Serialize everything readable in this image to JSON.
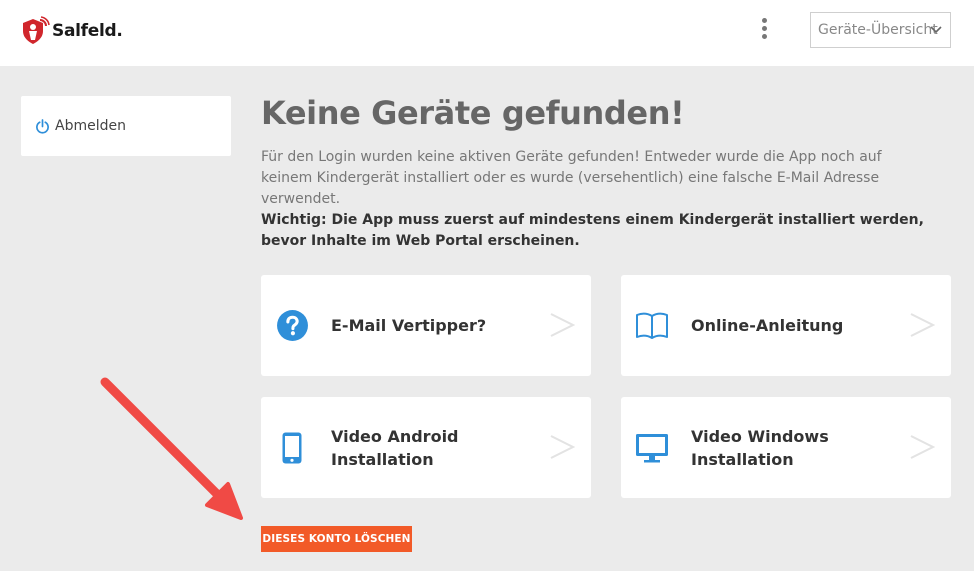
{
  "header": {
    "logo_text": "Salfeld.",
    "device_select": {
      "value": "Geräte-Übersicht"
    }
  },
  "sidebar": {
    "logout_label": "Abmelden"
  },
  "main": {
    "title": "Keine Geräte gefunden!",
    "description": "Für den Login wurden keine aktiven Geräte gefunden! Entweder wurde die App noch auf keinem Kindergerät installiert oder es wurde (versehentlich) eine falsche E-Mail Adresse verwendet.",
    "important": "Wichtig: Die App muss zuerst auf mindestens einem Kindergerät installiert werden, bevor Inhalte im Web Portal erscheinen."
  },
  "cards": [
    {
      "label": "E-Mail Vertipper?",
      "icon": "question-circle-icon"
    },
    {
      "label": "Online-Anleitung",
      "icon": "book-icon"
    },
    {
      "label": "Video Android Installation",
      "icon": "smartphone-icon"
    },
    {
      "label": "Video Windows Installation",
      "icon": "monitor-icon"
    }
  ],
  "delete_button": {
    "label": "DIESES KONTO LÖSCHEN"
  },
  "colors": {
    "accent": "#f25a28",
    "icon_blue": "#2f8fd9",
    "logo_red": "#d0262c",
    "annotation_red": "#f04a45",
    "background": "#ebebeb"
  }
}
